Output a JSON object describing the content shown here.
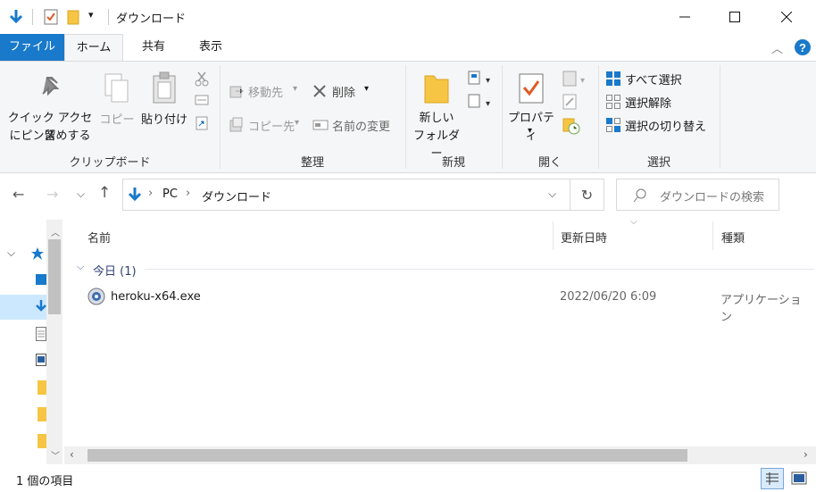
{
  "window": {
    "title": "ダウンロード"
  },
  "ribbon_tabs": [
    {
      "label": "ファイル"
    },
    {
      "label": "ホーム"
    },
    {
      "label": "共有"
    },
    {
      "label": "表示"
    }
  ],
  "ribbon": {
    "clipboard": {
      "pin_line1": "クイック アクセス",
      "pin_line2": "にピン留めする",
      "copy": "コピー",
      "paste": "貼り付け",
      "group": "クリップボード"
    },
    "organize": {
      "move_to": "移動先",
      "delete": "削除",
      "copy_to": "コピー先",
      "rename": "名前の変更",
      "group": "整理"
    },
    "new": {
      "new_folder_line1": "新しい",
      "new_folder_line2": "フォルダー",
      "group": "新規"
    },
    "open": {
      "properties": "プロパティ",
      "group": "開く"
    },
    "select": {
      "select_all": "すべて選択",
      "select_none": "選択解除",
      "invert": "選択の切り替え",
      "group": "選択"
    }
  },
  "address": {
    "crumbs": [
      "PC",
      "ダウンロード"
    ],
    "search_placeholder": "ダウンロードの検索"
  },
  "columns": {
    "name": "名前",
    "modified": "更新日時",
    "type": "種類"
  },
  "groups": [
    {
      "label": "今日 (1)",
      "files": [
        {
          "name": "heroku-x64.exe",
          "modified": "2022/06/20 6:09",
          "type": "アプリケーション"
        }
      ]
    }
  ],
  "status": {
    "count": "1 個の項目"
  },
  "colors": {
    "accent": "#1979ca",
    "ribbon_bg": "#f5f6f7",
    "selection": "#cce8ff"
  }
}
